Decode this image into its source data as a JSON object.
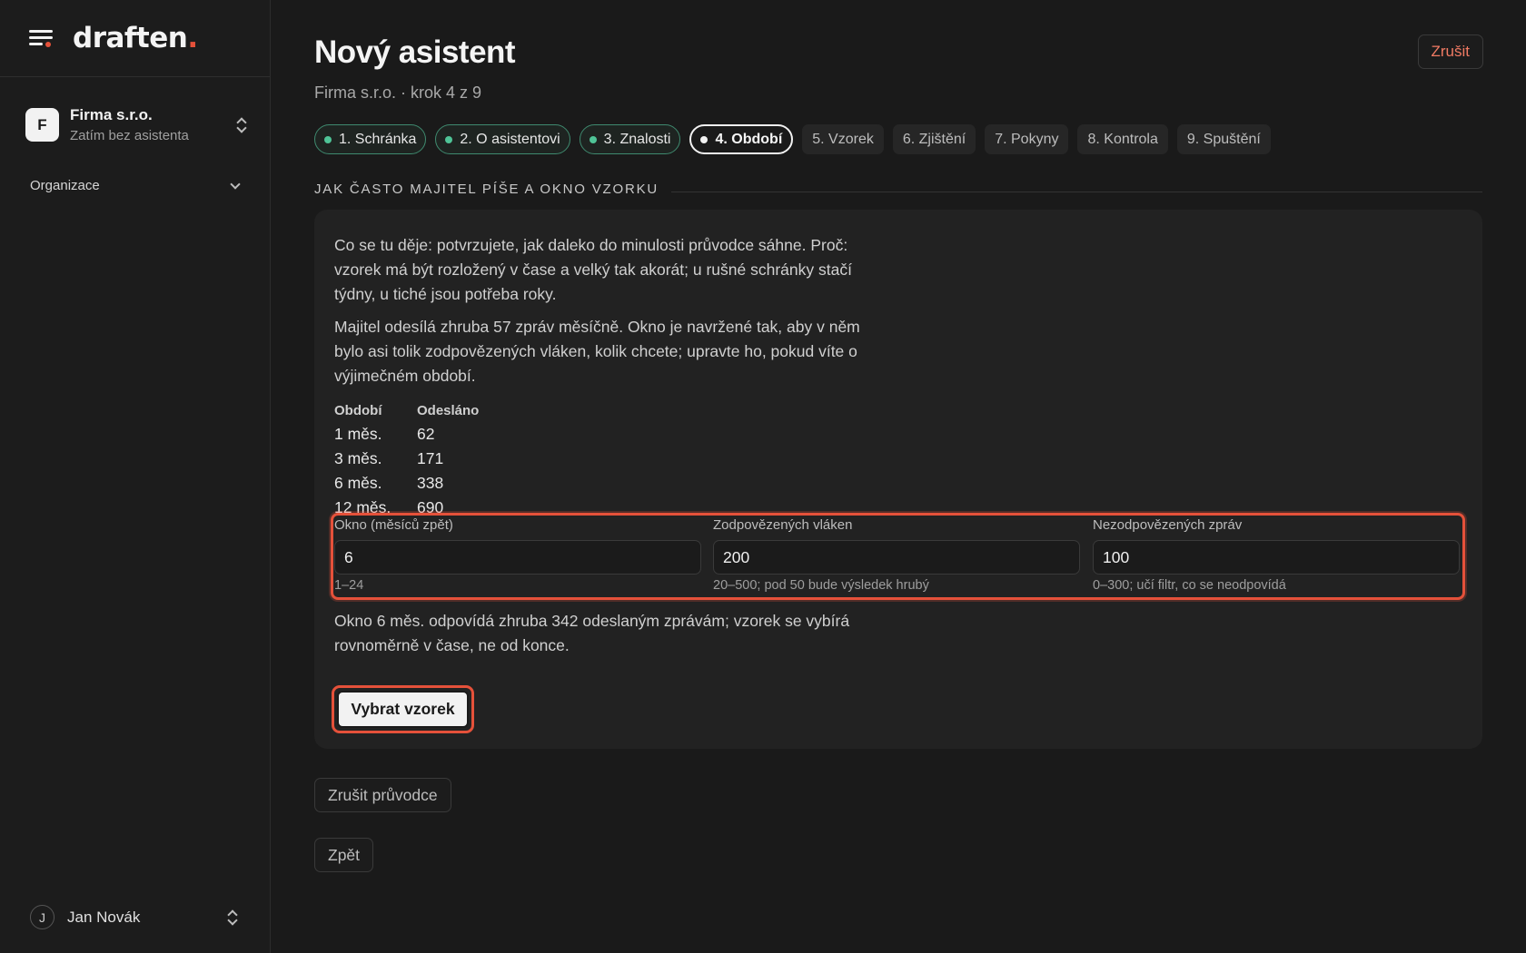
{
  "sidebar": {
    "logo": "draften",
    "logo_dot": ".",
    "org": {
      "initial": "F",
      "name": "Firma s.r.o.",
      "sub": "Zatím bez asistenta"
    },
    "section": "Organizace",
    "user": {
      "initial": "J",
      "name": "Jan Novák"
    }
  },
  "header": {
    "title": "Nový asistent",
    "subtitle": "Firma s.r.o. · krok 4 z 9",
    "cancel_label": "Zrušit"
  },
  "steps": [
    {
      "label": "1. Schránka",
      "state": "done"
    },
    {
      "label": "2. O asistentovi",
      "state": "done"
    },
    {
      "label": "3. Znalosti",
      "state": "done"
    },
    {
      "label": "4. Období",
      "state": "current"
    },
    {
      "label": "5. Vzorek",
      "state": "todo"
    },
    {
      "label": "6. Zjištění",
      "state": "todo"
    },
    {
      "label": "7. Pokyny",
      "state": "todo"
    },
    {
      "label": "8. Kontrola",
      "state": "todo"
    },
    {
      "label": "9. Spuštění",
      "state": "todo"
    }
  ],
  "section": {
    "heading": "JAK ČASTO MAJITEL PÍŠE A OKNO VZORKU",
    "intro": "Co se tu děje: potvrzujete, jak daleko do minulosti průvodce sáhne. Proč: vzorek má být rozložený v čase a velký tak akorát; u rušné schránky stačí týdny, u tiché jsou potřeba roky.",
    "info": "Majitel odesílá zhruba 57 zpráv měsíčně. Okno je navržené tak, aby v něm bylo asi tolik zodpovězených vláken, kolik chcete; upravte ho, pokud víte o výjimečném období.",
    "stats_headers": [
      "Období",
      "Odesláno"
    ],
    "stats": [
      [
        "1 měs.",
        "62"
      ],
      [
        "3 měs.",
        "171"
      ],
      [
        "6 měs.",
        "338"
      ],
      [
        "12 měs.",
        "690"
      ]
    ],
    "fields": [
      {
        "label": "Okno (měsíců zpět)",
        "value": "6",
        "hint": "1–24"
      },
      {
        "label": "Zodpovězených vláken",
        "value": "200",
        "hint": "20–500; pod 50 bude výsledek hrubý"
      },
      {
        "label": "Nezodpovězených zpráv",
        "value": "100",
        "hint": "0–300; učí filtr, co se neodpovídá"
      }
    ],
    "note": "Okno 6 měs. odpovídá zhruba 342 odeslaným zprávám; vzorek se vybírá rovnoměrně v čase, ne od konce.",
    "primary_label": "Vybrat vzorek"
  },
  "footer": {
    "cancel_wizard": "Zrušit průvodce",
    "back": "Zpět"
  },
  "colors": {
    "accent": "#e5513a",
    "done": "#4fc497"
  }
}
